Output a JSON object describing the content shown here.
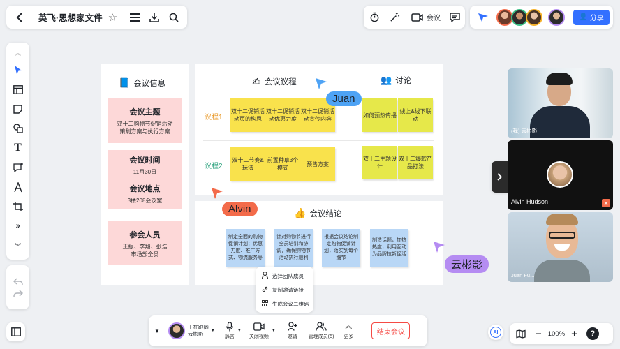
{
  "header": {
    "doc_title": "英飞·思想家文件",
    "meeting_label": "会议",
    "share_label": "分享"
  },
  "canvas": {
    "info": {
      "title": "会议信息",
      "topic_heading": "会议主题",
      "topic_text_1": "双十二购物节促销活动",
      "topic_text_2": "策划方案与执行方案",
      "time_heading": "会议时间",
      "time_value": "11月30日",
      "place_heading": "会议地点",
      "place_value": "3楼208会议室",
      "people_heading": "参会人员",
      "people_text_1": "王振、李翔、张浩",
      "people_text_2": "市场部全员"
    },
    "agenda": {
      "title": "会议议程",
      "row1_label": "议程1",
      "row2_label": "议程2",
      "row1_notes": [
        "双十二促销活动页的构思",
        "双十二促销活动优惠力度",
        "双十二促销活动宣传内容"
      ],
      "row2_notes": [
        "双十二节奏&玩法",
        "前置种草3个模式",
        "预售方案"
      ]
    },
    "discuss": {
      "title": "讨论",
      "row1_notes": [
        "如何预热传播",
        "线上&线下联动"
      ],
      "row2_notes": [
        "双十二主题设计",
        "双十二爆款产品打法"
      ]
    },
    "conclusion": {
      "title": "会议结论",
      "notes": [
        "制定全面的购物促销计划：优惠力度、推广方式、物流服务等",
        "针对购物节进行全员培训和协调，确保购物节活动执行顺利",
        "根据会议结论制定购物促销计划，落实到每个细节",
        "制造话题，加热热度，利用互动为品牌拉新促活"
      ]
    },
    "cursors": {
      "juan": "Juan",
      "alvin": "Alvin",
      "yunbin": "云彬影"
    }
  },
  "context_menu": {
    "items": [
      "选择团队成员",
      "复制邀请链接",
      "生成会议二维码"
    ]
  },
  "videos": {
    "top_name": "(我) 云彬影",
    "middle_name": "Alvin Hudson",
    "bottom_name": "Juan Fu..."
  },
  "bottom_bar": {
    "following_line1": "正在跟随",
    "following_line2": "云彬影",
    "mute": "静音",
    "video_off": "关闭视频",
    "invite": "邀请",
    "manage": "管理成员(5)",
    "more": "更多",
    "end": "结束会议"
  },
  "zoom": {
    "level": "100%"
  },
  "colors": {
    "accent": "#3370ff",
    "end_red": "#f54a45",
    "pink_card": "#fdd8d8",
    "sticky_yellow": "#f9e24c",
    "sticky_blue": "#b9d7f6",
    "juan_tag": "#4ea3f5",
    "alvin_tag": "#f36b4a",
    "yunbin_tag": "#b58cf2"
  }
}
